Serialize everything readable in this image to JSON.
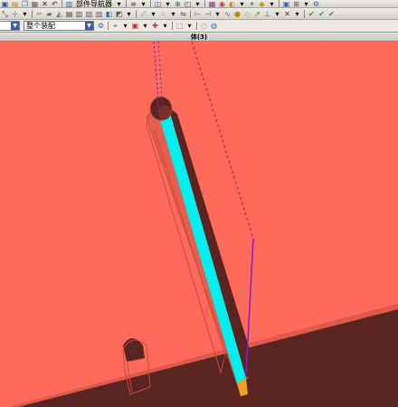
{
  "toolbar_top": {
    "display_part_label": "部件导航器"
  },
  "selection_bar": {
    "type_filter_value": "",
    "scope_value": "整个装配"
  },
  "viewport": {
    "title": "体(3)"
  },
  "icons": [
    "save-icon",
    "open-icon",
    "copy-icon",
    "cut-icon",
    "undo-icon",
    "sketch-icon",
    "extrude-icon",
    "hole-icon",
    "shell-icon",
    "blend-icon",
    "chamfer-icon",
    "snap-icon",
    "select-icon",
    "zoom-icon",
    "rotate-icon",
    "render-icon"
  ],
  "colors": {
    "viewport_bg": "#ff6a5a",
    "body_shadow": "#5a2420",
    "highlight_face": "#00f0f0",
    "edge_dashed": "#e0003c",
    "axis_violet": "#7a1fd6",
    "edge_orange": "#e08a00"
  }
}
